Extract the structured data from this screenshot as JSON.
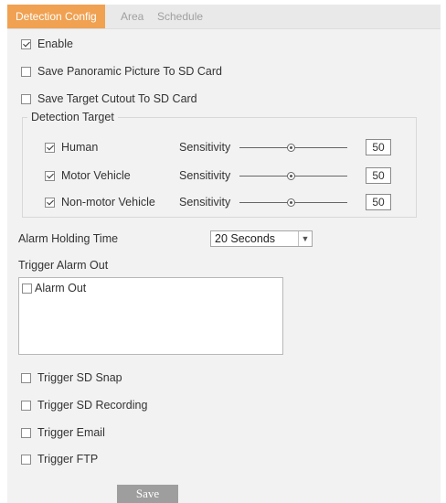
{
  "tabs": [
    {
      "label": "Detection Config",
      "active": true
    },
    {
      "label": "Area",
      "active": false
    },
    {
      "label": "Schedule",
      "active": false
    }
  ],
  "enable": {
    "label": "Enable",
    "checked": true
  },
  "save_panoramic": {
    "label": "Save Panoramic Picture To SD Card",
    "checked": false
  },
  "save_target_cutout": {
    "label": "Save Target Cutout To SD Card",
    "checked": false
  },
  "detection_target": {
    "legend": "Detection Target",
    "sensitivity_label": "Sensitivity",
    "targets": [
      {
        "label": "Human",
        "checked": true,
        "sensitivity": 50
      },
      {
        "label": "Motor Vehicle",
        "checked": true,
        "sensitivity": 50
      },
      {
        "label": "Non-motor Vehicle",
        "checked": true,
        "sensitivity": 50
      }
    ]
  },
  "alarm_holding_time": {
    "label": "Alarm Holding Time",
    "value": "20 Seconds"
  },
  "trigger_alarm_out": {
    "label": "Trigger Alarm Out",
    "items": [
      {
        "label": "Alarm Out",
        "checked": false
      }
    ]
  },
  "triggers": [
    {
      "label": "Trigger SD Snap",
      "checked": false
    },
    {
      "label": "Trigger SD Recording",
      "checked": false
    },
    {
      "label": "Trigger Email",
      "checked": false
    },
    {
      "label": "Trigger FTP",
      "checked": false
    }
  ],
  "save_label": "Save",
  "colors": {
    "active_tab": "#f0a151",
    "save_button": "#9e9e9e",
    "panel_bg": "#f2f2f2"
  }
}
